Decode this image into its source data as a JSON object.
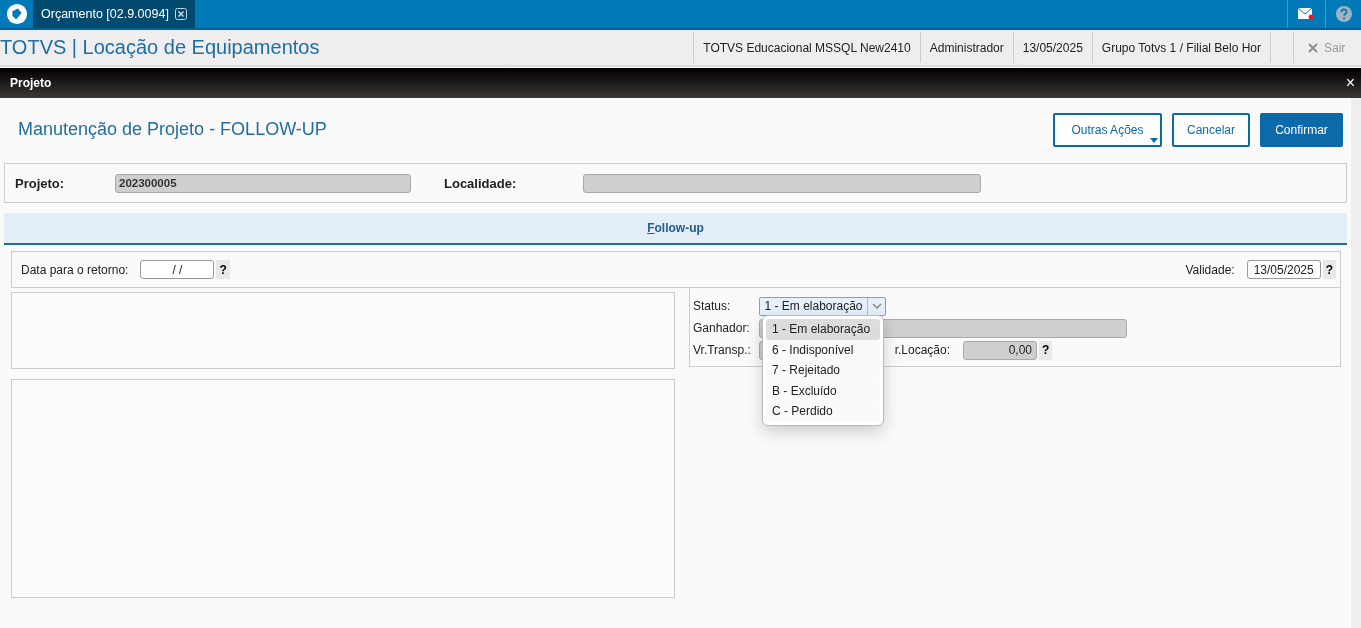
{
  "tab": {
    "title": "Orçamento [02.9.0094]"
  },
  "mail": {
    "unread": true
  },
  "header": {
    "title": "TOTVS | Locação de Equipamentos",
    "info": [
      "TOTVS Educacional MSSQL New2410",
      "Administrador",
      "13/05/2025",
      "Grupo Totvs 1 / Filial Belo Hor"
    ],
    "exit": "Sair"
  },
  "dialog": {
    "title": "Projeto",
    "close": "×",
    "heading": "Manutenção de Projeto - FOLLOW-UP",
    "buttons": [
      {
        "label": "Outras Ações",
        "kind": "menu"
      },
      {
        "label": "Cancelar",
        "kind": "secondary"
      },
      {
        "label": "Confirmar",
        "kind": "primary"
      }
    ]
  },
  "project_fields": [
    {
      "label": "Projeto:",
      "value": "202300005"
    },
    {
      "label": "Localidade:"
    }
  ],
  "section_tab": {
    "label": "Follow-up",
    "selected": true
  },
  "return_date": {
    "label": "Data para o retorno:",
    "value": "/ /",
    "help": "?"
  },
  "validity": {
    "label": "Validade:",
    "value": "13/05/2025",
    "help": "?"
  },
  "status": {
    "label": "Status:",
    "value": "1 - Em elaboração",
    "expanded": true,
    "options": [
      {
        "label": "1 - Em elaboração",
        "selected": true
      },
      {
        "label": "6 - Indisponível",
        "selected": false
      },
      {
        "label": "7 - Rejeitado",
        "selected": false
      },
      {
        "label": "B - Excluído",
        "selected": false
      },
      {
        "label": "C - Perdido",
        "selected": false
      }
    ]
  },
  "winner": {
    "label": "Ganhador:"
  },
  "transport": {
    "label": "Vr.Transp.:"
  },
  "rental": {
    "label": "r.Locação:",
    "value": "0,00",
    "help": "?"
  }
}
